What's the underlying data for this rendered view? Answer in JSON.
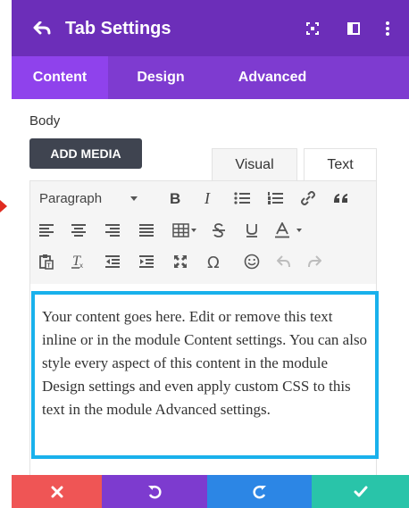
{
  "header": {
    "title": "Tab Settings",
    "background": "#6c2eb9",
    "icons": [
      "back-arrow-icon",
      "expand-icon",
      "split-view-icon",
      "more-icon"
    ]
  },
  "tabs": [
    {
      "label": "Content",
      "active": true
    },
    {
      "label": "Design",
      "active": false
    },
    {
      "label": "Advanced",
      "active": false
    }
  ],
  "body_section": {
    "label": "Body",
    "add_media_label": "ADD MEDIA",
    "editor_tabs": {
      "visual": "Visual",
      "text": "Text"
    }
  },
  "toolbar": {
    "format_select": "Paragraph",
    "row1": [
      "bold-icon",
      "italic-icon",
      "bullet-list-icon",
      "numbered-list-icon",
      "link-icon",
      "blockquote-icon"
    ],
    "row2": [
      "align-left-icon",
      "align-center-icon",
      "align-right-icon",
      "align-justify-icon",
      "table-icon",
      "strikethrough-icon",
      "underline-icon",
      "text-color-icon"
    ],
    "row3": [
      "paste-icon",
      "clear-format-icon",
      "outdent-icon",
      "indent-icon",
      "fullscreen-icon",
      "special-char-icon",
      "emoji-icon",
      "undo-icon",
      "redo-icon"
    ]
  },
  "editor": {
    "content": "Your content goes here. Edit or remove this text inline or in the module Content settings. You can also style every aspect of this content in the module Design settings and even apply custom CSS to this text in the module Advanced settings.",
    "border_color": "#19b1ec"
  },
  "footer": {
    "buttons": [
      {
        "name": "cancel",
        "icon": "close-icon",
        "color": "#ef5555"
      },
      {
        "name": "undo",
        "icon": "undo-icon",
        "color": "#7d3bcf"
      },
      {
        "name": "redo",
        "icon": "redo-icon",
        "color": "#2c86e5"
      },
      {
        "name": "save",
        "icon": "check-icon",
        "color": "#29c4a9"
      }
    ]
  }
}
